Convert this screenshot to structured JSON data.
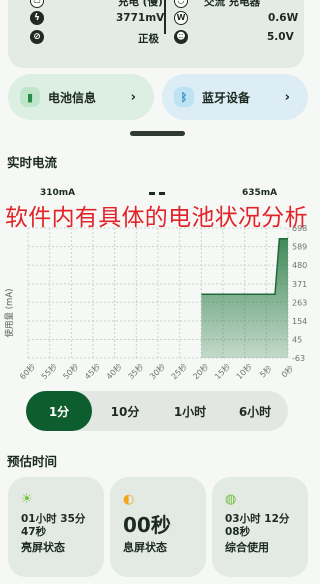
{
  "status_card": {
    "row1_left_label": "充电 (慢)",
    "row1_right_label": "交流 充电器",
    "voltage": "3771mV",
    "power": "0.6W",
    "polarity": "正极",
    "usb_voltage": "5.0V",
    "icons": [
      "charge-icon",
      "bolt-icon",
      "polarity-icon",
      "ac-icon",
      "watt-icon",
      "plug-icon"
    ]
  },
  "buttons": {
    "battery_info": "电池信息",
    "bluetooth": "蓝牙设备"
  },
  "realtime": {
    "title": "实时电流",
    "max_label": "310mA",
    "min_label": "635mA",
    "overlay": "软件内有具体的电池状况分析"
  },
  "chart_data": {
    "type": "area",
    "ylabel": "使用量 (mA)",
    "yticks": [
      698,
      589,
      480,
      371,
      263,
      154,
      45,
      -63
    ],
    "ylim": [
      -63,
      698
    ],
    "xticks": [
      "60秒",
      "55秒",
      "50秒",
      "45秒",
      "40秒",
      "35秒",
      "30秒",
      "25秒",
      "20秒",
      "15秒",
      "10秒",
      "5秒",
      "0秒"
    ],
    "x": [
      60,
      55,
      50,
      45,
      40,
      35,
      30,
      25,
      20,
      15,
      10,
      5,
      3,
      2,
      0
    ],
    "y": [
      null,
      null,
      null,
      null,
      null,
      null,
      null,
      null,
      310,
      310,
      310,
      310,
      310,
      635,
      635
    ],
    "color": "#2e7d4a",
    "grid": true
  },
  "segments": [
    "1分",
    "10分",
    "1小时",
    "6小时"
  ],
  "segments_active": "1分",
  "estimate": {
    "title": "预估时间",
    "cards": [
      {
        "time": "01小时 35分\n47秒",
        "label": "亮屏状态",
        "icon": "sun-icon"
      },
      {
        "time": "00秒",
        "label": "息屏状态",
        "icon": "moon-icon"
      },
      {
        "time": "03小时 12分\n08秒",
        "label": "综合使用",
        "icon": "mixed-icon"
      }
    ]
  },
  "colors": {
    "accent": "#0d5d2f",
    "chart": "#2e7d4a",
    "overlay": "#e2232a"
  }
}
